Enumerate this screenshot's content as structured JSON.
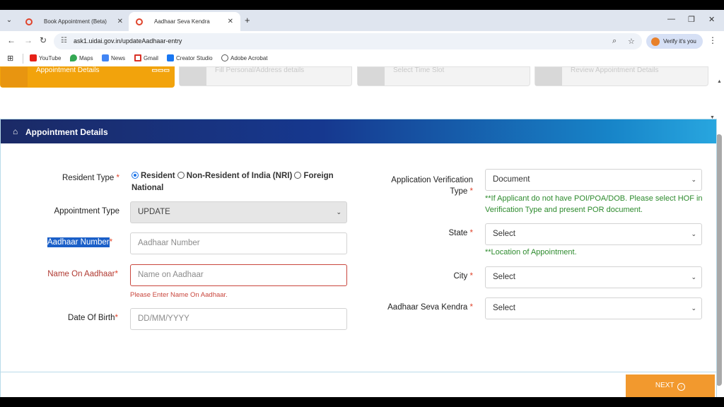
{
  "browser": {
    "tabs": [
      {
        "title": "Book Appointment (Beta)",
        "active": false
      },
      {
        "title": "Aadhaar Seva Kendra",
        "active": true
      }
    ],
    "url": "ask1.uidai.gov.in/updateAadhaar-entry",
    "profile_label": "Verify it's you",
    "bookmarks": [
      {
        "label": "YouTube",
        "icon": "youtube-icon",
        "color": "#e62117"
      },
      {
        "label": "Maps",
        "icon": "maps-icon",
        "color": "#34a853"
      },
      {
        "label": "News",
        "icon": "news-icon",
        "color": "#4285f4"
      },
      {
        "label": "Gmail",
        "icon": "gmail-icon",
        "color": "#d93025"
      },
      {
        "label": "Creator Studio",
        "icon": "creator-studio-icon",
        "color": "#1877f2"
      },
      {
        "label": "Adobe Acrobat",
        "icon": "globe-icon",
        "color": "#555555"
      }
    ]
  },
  "steps": [
    {
      "label": "Appointment Details",
      "active": true
    },
    {
      "label": "Fill Personal/Address details",
      "active": false
    },
    {
      "label": "Select Time Slot",
      "active": false
    },
    {
      "label": "Review Appointment Details",
      "active": false
    }
  ],
  "panel": {
    "title": "Appointment Details"
  },
  "form_left": {
    "resident_type_label": "Resident Type",
    "resident_options": [
      "Resident",
      "Non-Resident of India (NRI)",
      "Foreign National"
    ],
    "resident_selected": "Resident",
    "appointment_type_label": "Appointment Type",
    "appointment_type_value": "UPDATE",
    "aadhaar_number_label": "Aadhaar Number",
    "aadhaar_number_placeholder": "Aadhaar Number",
    "name_label": "Name On Aadhaar",
    "name_placeholder": "Name on Aadhaar",
    "name_error": "Please Enter Name On Aadhaar.",
    "dob_label": "Date Of Birth",
    "dob_placeholder": "DD/MM/YYYY"
  },
  "form_right": {
    "verification_label_1": "Application Verification",
    "verification_label_2": "Type",
    "verification_value": "Document",
    "verification_hint": "**If Applicant do not have POI/POA/DOB. Please select HOF in Verification Type and present POR document.",
    "state_label": "State",
    "state_value": "Select",
    "state_hint": "**Location of Appointment.",
    "city_label": "City",
    "city_value": "Select",
    "kendra_label": "Aadhaar Seva Kendra",
    "kendra_value": "Select"
  },
  "next_label": "NEXT",
  "colors": {
    "accent": "#f2a30c",
    "next_button": "#f2992e",
    "error": "#c9463d",
    "hint_green": "#2e8b2e",
    "header_start": "#1b2a66",
    "header_end": "#28a6df"
  }
}
